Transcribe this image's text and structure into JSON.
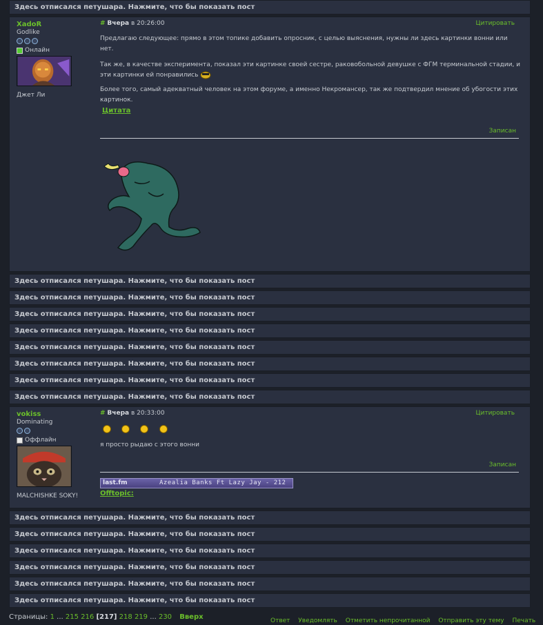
{
  "collapsed_label": "Здесь отписался петушара. Нажмите, что бы показать пост",
  "post1": {
    "username": "XadoR",
    "rank": "Godlike",
    "status": "Онлайн",
    "signature_name": "Джет Ли",
    "hash": "#",
    "day": "Вчера",
    "time": "в 20:26:00",
    "quote_button": "Цитировать",
    "para1": "Предлагаю следующее: прямо в этом топике добавить опросник, с целью выяснения, нужны ли здесь картинки вонни или нет.",
    "para2": "Так же, в качестве эксперимента, показал эти картинке своей сестре, раковобольной девушке с ФГМ терминальной стадии, и эти картинки ей понравились",
    "para3": "Более того, самый адекватный человек на этом форуме, а именно Некромансер, так же подтвердил мнение об убогости этих картинок.",
    "quote_link": "Цитата",
    "recorded": "Записан"
  },
  "post2": {
    "username": "vokiss",
    "rank": "Dominating",
    "status": "Оффлайн",
    "signature_name": "MALCHISHKE SOKY!",
    "hash": "#",
    "day": "Вчера",
    "time": "в 20:33:00",
    "quote_button": "Цитировать",
    "text": "я просто рыдаю с этого вонни",
    "recorded": "Записан",
    "lastfm_logo": "last.fm",
    "lastfm_track": "Azealia Banks Ft  Lazy Jay - 212",
    "offtopic": "Offtopic:"
  },
  "pager": {
    "label": "Страницы:",
    "first": "1",
    "dots1": "...",
    "p215": "215",
    "p216": "216",
    "current": "[217]",
    "p218": "218",
    "p219": "219",
    "dots2": "...",
    "last": "230",
    "top": "Вверх"
  },
  "actions": {
    "reply": "Ответ",
    "notify": "Уведомлять",
    "mark_unread": "Отметить непрочитанной",
    "send_topic": "Отправить эту тему",
    "print": "Печать"
  },
  "colors": {
    "accent": "#6bbf2b",
    "panel": "#2a3040",
    "background": "#1c2028"
  }
}
